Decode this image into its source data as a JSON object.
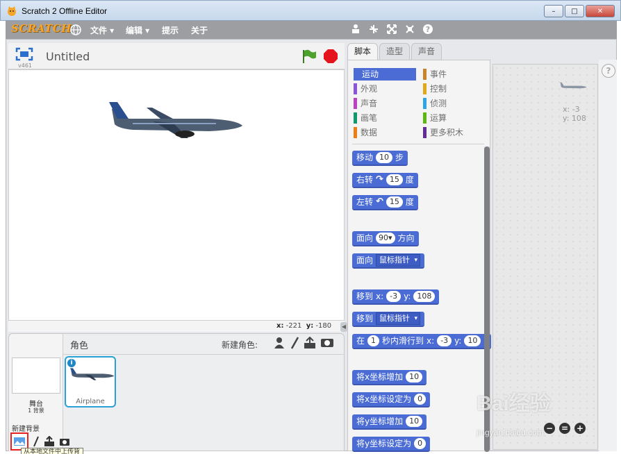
{
  "window": {
    "title": "Scratch 2 Offline Editor",
    "minimize": "–",
    "maximize": "□",
    "close": "✕"
  },
  "menubar": {
    "logo": "SCRATCH",
    "file": "文件 ▾",
    "edit": "编辑 ▾",
    "tips": "提示",
    "about": "关于",
    "tools": [
      "duplicate-icon",
      "delete-icon",
      "grow-icon",
      "shrink-icon",
      "help-icon"
    ],
    "help_glyph": "?"
  },
  "stage": {
    "version": "v461",
    "project_title": "Untitled",
    "coords": {
      "x_label": "x:",
      "x": "-221",
      "y_label": "y:",
      "y": "-180"
    }
  },
  "sprites": {
    "label": "角色",
    "new_sprite_label": "新建角色:",
    "stage_label": "舞台",
    "stage_bg_count": "1 背景",
    "new_backdrop": "新建背景",
    "tooltip": "从本地文件中上传背景",
    "info": "i",
    "items": [
      {
        "name": "Airplane"
      }
    ]
  },
  "tabs": [
    "脚本",
    "造型",
    "声音"
  ],
  "categories": [
    {
      "label": "运动",
      "color": "#4a6cd4",
      "active": true
    },
    {
      "label": "外观",
      "color": "#8a55d7"
    },
    {
      "label": "声音",
      "color": "#bb42c3"
    },
    {
      "label": "画笔",
      "color": "#0e9a6c"
    },
    {
      "label": "数据",
      "color": "#ee7d16"
    },
    {
      "label": "事件",
      "color": "#c88330"
    },
    {
      "label": "控制",
      "color": "#e1a91a"
    },
    {
      "label": "侦测",
      "color": "#2ca5e2"
    },
    {
      "label": "运算",
      "color": "#5cb712"
    },
    {
      "label": "更多积木",
      "color": "#632d99"
    }
  ],
  "blocks": {
    "move": {
      "pre": "移动",
      "val": "10",
      "post": "步"
    },
    "turn_right": {
      "pre": "右转",
      "glyph": "↷",
      "val": "15",
      "post": "度"
    },
    "turn_left": {
      "pre": "左转",
      "glyph": "↶",
      "val": "15",
      "post": "度"
    },
    "point_dir": {
      "pre": "面向",
      "val": "90▾",
      "post": "方向"
    },
    "point_towards": {
      "pre": "面向",
      "drop": "鼠标指针"
    },
    "goto_xy": {
      "pre": "移到",
      "xl": "x:",
      "x": "-3",
      "yl": "y:",
      "y": "108"
    },
    "goto": {
      "pre": "移到",
      "drop": "鼠标指针"
    },
    "glide": {
      "pre": "在",
      "secs": "1",
      "mid": "秒内滑行到",
      "xl": "x:",
      "x": "-3",
      "yl": "y:",
      "y": "10"
    },
    "change_x": {
      "pre": "将x坐标增加",
      "val": "10"
    },
    "set_x": {
      "pre": "将x坐标设定为",
      "val": "0"
    },
    "change_y": {
      "pre": "将y坐标增加",
      "val": "10"
    },
    "set_y": {
      "pre": "将y坐标设定为",
      "val": "0"
    }
  },
  "scripts_area": {
    "x_label": "x: -3",
    "y_label": "y: 108",
    "zoom_out": "−",
    "zoom_reset": "=",
    "zoom_in": "+"
  },
  "help_side": "?",
  "watermark": {
    "text": "Bai经验",
    "sub": "jingyan.baidu.com"
  },
  "colors": {
    "motion": "#4a6cd4",
    "menubar": "#9c9ea1",
    "highlight": "#e8231f",
    "sprite_select": "#2aa0d8"
  }
}
